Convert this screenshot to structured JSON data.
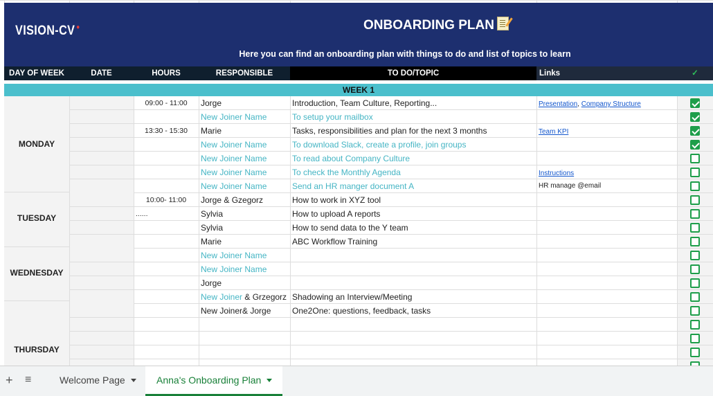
{
  "header": {
    "logo": "VISION-CV",
    "title": "ONBOARDING PLAN",
    "subtitle": "Here you can find an onboarding plan with things to do and list of topics to learn"
  },
  "columns": {
    "day": "DAY OF WEEK",
    "date": "DATE",
    "hours": "HOURS",
    "responsible": "RESPONSIBLE",
    "todo": "TO DO/TOPIC",
    "links": "Links",
    "done": "✓"
  },
  "week_label": "WEEK 1",
  "days": [
    "MONDAY",
    "TUESDAY",
    "WEDNESDAY",
    "THURSDAY"
  ],
  "rows": [
    {
      "hours": "09:00 - 11:00",
      "resp": "Jorge",
      "todo": "Introduction, Team Culture, Reporting...",
      "link1": "Presentation",
      "sep": ", ",
      "link2": "Company Structure",
      "done": true
    },
    {
      "hours": "",
      "resp": "New Joiner Name",
      "todo": "To setup your mailbox",
      "done": true
    },
    {
      "hours": "13:30 - 15:30",
      "resp": "Marie",
      "todo": "Tasks, responsibilities and plan for the next 3 months",
      "link1": "Team KPI",
      "done": true
    },
    {
      "hours": "",
      "resp": "New Joiner Name",
      "todo": "To download Slack, create a profile, join groups",
      "done": true
    },
    {
      "hours": "",
      "resp": "New Joiner Name",
      "todo": "To read about Company Culture",
      "done": false
    },
    {
      "hours": "",
      "resp": "New Joiner Name",
      "todo": "To check the Monthly Agenda",
      "link1": "Instructions",
      "done": false
    },
    {
      "hours": "",
      "resp": "New Joiner Name",
      "todo": "Send an HR manger document A",
      "linktext": "HR manage @email",
      "done": false
    },
    {
      "hours": "10:00- 11:00",
      "resp": "Jorge & Gzegorz",
      "todo": "How to work in XYZ tool",
      "done": false
    },
    {
      "hours": "......",
      "resp": "Sylvia",
      "todo": "How to upload A reports",
      "done": false
    },
    {
      "hours": "",
      "resp": "Sylvia",
      "todo": "How to send data to the Y team",
      "done": false
    },
    {
      "hours": "",
      "resp": "Marie",
      "todo": "ABC Workflow  Training",
      "done": false
    },
    {
      "hours": "",
      "resp": "New Joiner Name",
      "todo": "",
      "done": false
    },
    {
      "hours": "",
      "resp": "New Joiner Name",
      "todo": "",
      "done": false
    },
    {
      "hours": "",
      "resp": "Jorge",
      "todo": "",
      "done": false
    },
    {
      "hours": "",
      "resp_a": "New Joiner",
      "resp_b": " & Grzegorz",
      "todo": "Shadowing an Interview/Meeting",
      "done": false
    },
    {
      "hours": "",
      "resp": "New Joiner& Jorge",
      "todo": "One2One: questions, feedback, tasks",
      "done": false
    },
    {
      "hours": "",
      "resp": "",
      "todo": "",
      "done": false
    },
    {
      "hours": "",
      "resp": "",
      "todo": "",
      "done": false
    },
    {
      "hours": "",
      "resp": "",
      "todo": "",
      "done": false
    },
    {
      "hours": "",
      "resp": "",
      "todo": "",
      "done": false
    }
  ],
  "tabs": {
    "add": "+",
    "menu": "≡",
    "sheet1": "Welcome Page",
    "sheet2": "Anna's Onboarding Plan"
  },
  "colors": {
    "banner": "#1d2f6f",
    "week_bar": "#4bbfcc",
    "header_dark": "#1f2a3c",
    "checkbox": "#1e9e4a",
    "teal_text": "#45b5c4",
    "active_tab": "#188038"
  }
}
